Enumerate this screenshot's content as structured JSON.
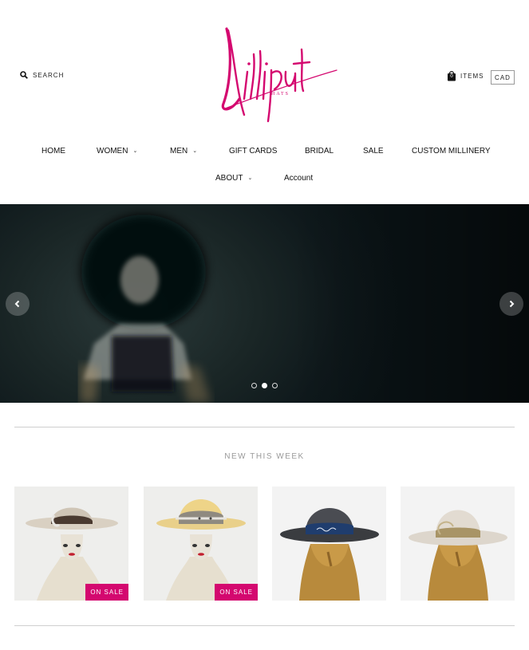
{
  "header": {
    "search_label": "SEARCH",
    "logo_text": "Lilliput",
    "logo_subtext": "HATS",
    "cart_count": "0",
    "items_label": "ITEMS",
    "currency": "CAD"
  },
  "nav": {
    "row1": [
      {
        "label": "HOME"
      },
      {
        "label": "WOMEN",
        "dropdown": true
      },
      {
        "label": "MEN",
        "dropdown": true
      },
      {
        "label": "GIFT CARDS"
      },
      {
        "label": "BRIDAL"
      },
      {
        "label": "SALE"
      },
      {
        "label": "CUSTOM MILLINERY"
      }
    ],
    "row2": [
      {
        "label": "ABOUT",
        "dropdown": true
      },
      {
        "label": "Account"
      }
    ],
    "chevron": "⌄"
  },
  "hero": {
    "active_slide": 1,
    "slide_count": 3
  },
  "new_this_week": {
    "title": "NEW THIS WEEK",
    "products": [
      {
        "badge": "ON SALE",
        "style": "tan-brown-band"
      },
      {
        "badge": "ON SALE",
        "style": "yellow-grey-band"
      },
      {
        "badge": "",
        "style": "charcoal-bandana"
      },
      {
        "badge": "",
        "style": "cream-feather"
      }
    ]
  },
  "colors": {
    "brand": "#d4086f",
    "text": "#111111",
    "muted": "#9a9a9a",
    "hero_bg": "#0f191c"
  }
}
